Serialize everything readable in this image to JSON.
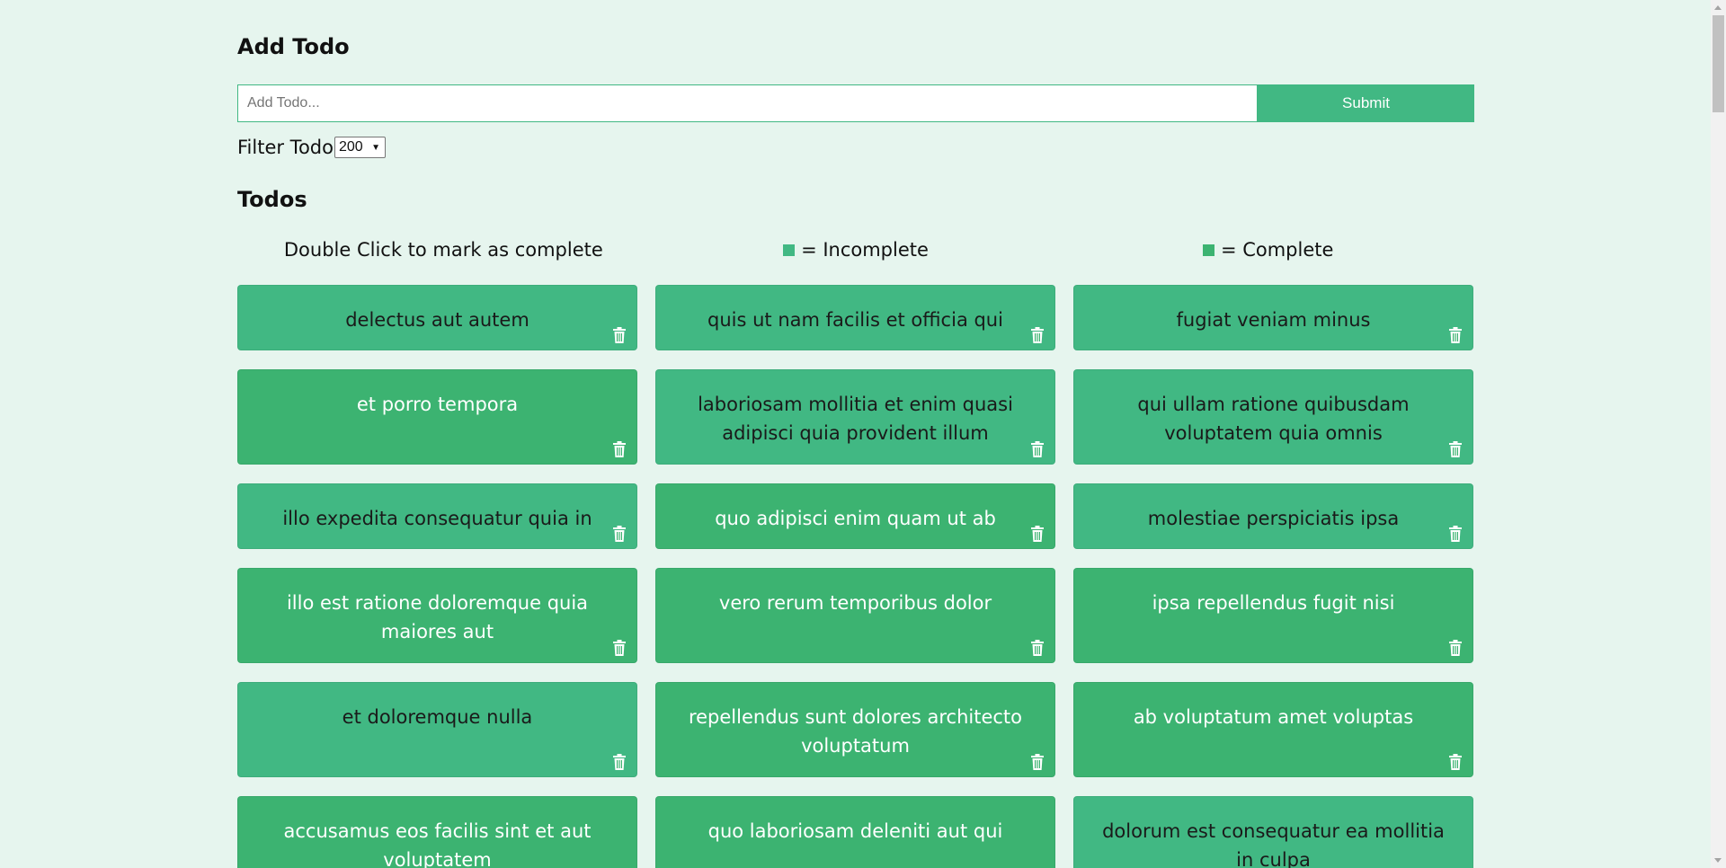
{
  "add_section": {
    "title": "Add Todo",
    "input_placeholder": "Add Todo...",
    "submit_label": "Submit"
  },
  "filter": {
    "label": "Filter Todo",
    "selected": "200"
  },
  "todos_section": {
    "title": "Todos",
    "legend": {
      "hint": "Double Click to mark as complete",
      "incomplete_label": "= Incomplete",
      "complete_label": "= Complete",
      "incomplete_color": "#41b883",
      "complete_color": "#3cb371"
    }
  },
  "todos": [
    {
      "title": "delectus aut autem",
      "status": "incomplete"
    },
    {
      "title": "quis ut nam facilis et officia qui",
      "status": "incomplete"
    },
    {
      "title": "fugiat veniam minus",
      "status": "incomplete"
    },
    {
      "title": "et porro tempora",
      "status": "complete"
    },
    {
      "title": "laboriosam mollitia et enim quasi adipisci quia provident illum",
      "status": "incomplete"
    },
    {
      "title": "qui ullam ratione quibusdam voluptatem quia omnis",
      "status": "incomplete"
    },
    {
      "title": "illo expedita consequatur quia in",
      "status": "incomplete"
    },
    {
      "title": "quo adipisci enim quam ut ab",
      "status": "complete"
    },
    {
      "title": "molestiae perspiciatis ipsa",
      "status": "incomplete"
    },
    {
      "title": "illo est ratione doloremque quia maiores aut",
      "status": "complete"
    },
    {
      "title": "vero rerum temporibus dolor",
      "status": "complete"
    },
    {
      "title": "ipsa repellendus fugit nisi",
      "status": "complete"
    },
    {
      "title": "et doloremque nulla",
      "status": "incomplete"
    },
    {
      "title": "repellendus sunt dolores architecto voluptatum",
      "status": "complete"
    },
    {
      "title": "ab voluptatum amet voluptas",
      "status": "complete"
    },
    {
      "title": "accusamus eos facilis sint et aut voluptatem",
      "status": "complete"
    },
    {
      "title": "quo laboriosam deleniti aut qui",
      "status": "complete"
    },
    {
      "title": "dolorum est consequatur ea mollitia in culpa",
      "status": "incomplete"
    }
  ],
  "icons": {
    "delete": "trash-icon"
  }
}
